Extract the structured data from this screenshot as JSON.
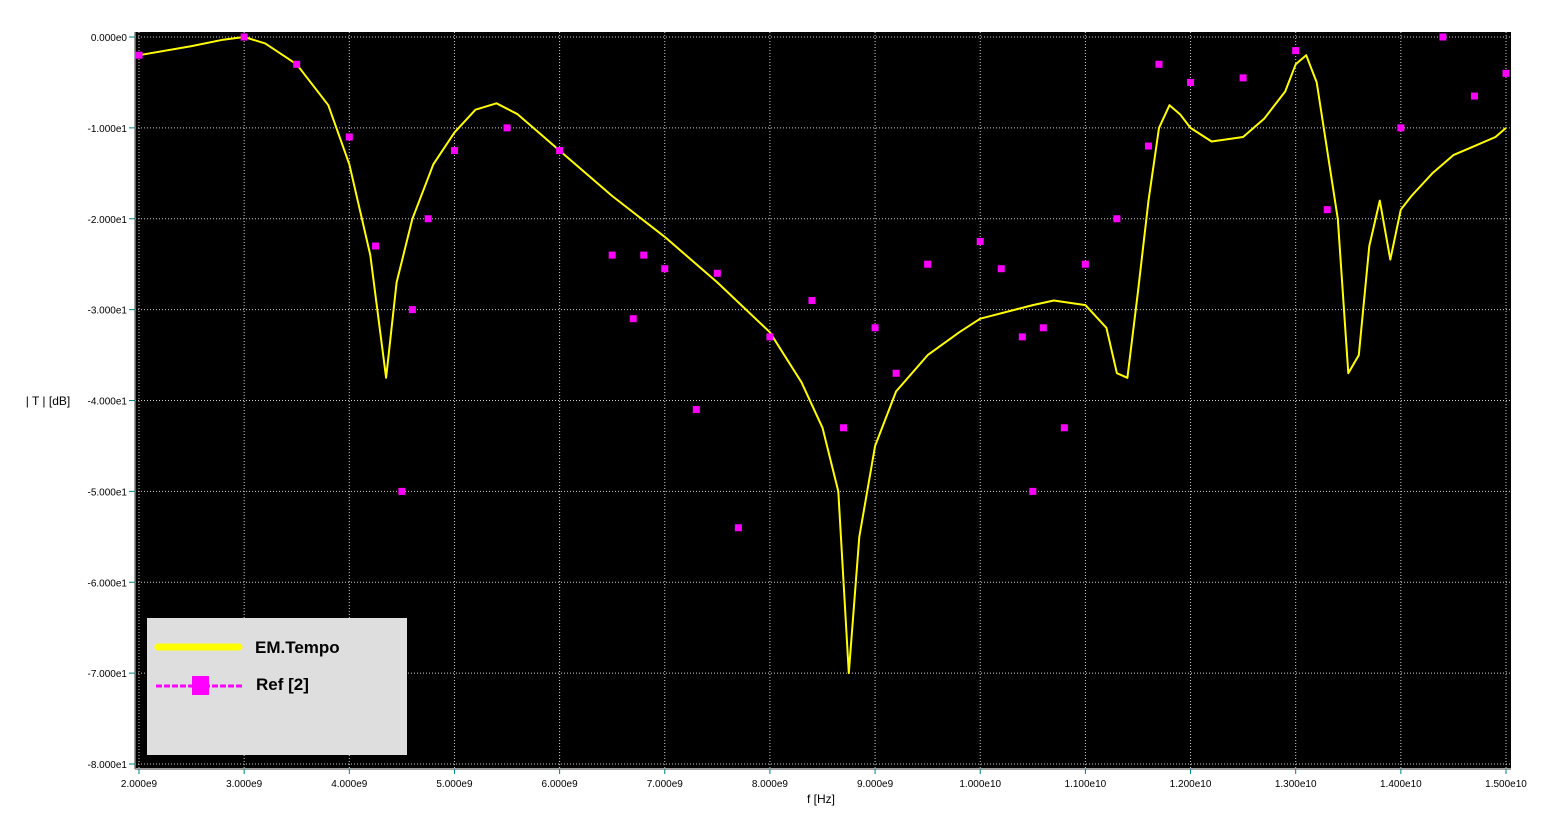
{
  "chart_data": {
    "type": "line",
    "title": "",
    "xlabel": "f [Hz]",
    "ylabel": "| T | [dB]",
    "xlim": [
      2000000000.0,
      15000000000.0
    ],
    "ylim": [
      -80,
      0
    ],
    "grid": true,
    "legend_position": "bottom-left",
    "x_ticks": [
      {
        "value": 2000000000.0,
        "label": "2.000e9"
      },
      {
        "value": 3000000000.0,
        "label": "3.000e9"
      },
      {
        "value": 4000000000.0,
        "label": "4.000e9"
      },
      {
        "value": 5000000000.0,
        "label": "5.000e9"
      },
      {
        "value": 6000000000.0,
        "label": "6.000e9"
      },
      {
        "value": 7000000000.0,
        "label": "7.000e9"
      },
      {
        "value": 8000000000.0,
        "label": "8.000e9"
      },
      {
        "value": 9000000000.0,
        "label": "9.000e9"
      },
      {
        "value": 10000000000.0,
        "label": "1.000e10"
      },
      {
        "value": 11000000000.0,
        "label": "1.100e10"
      },
      {
        "value": 12000000000.0,
        "label": "1.200e10"
      },
      {
        "value": 13000000000.0,
        "label": "1.300e10"
      },
      {
        "value": 14000000000.0,
        "label": "1.400e10"
      },
      {
        "value": 15000000000.0,
        "label": "1.500e10"
      }
    ],
    "y_ticks": [
      {
        "value": 0,
        "label": "0.000e0"
      },
      {
        "value": -10,
        "label": "-1.000e1"
      },
      {
        "value": -20,
        "label": "-2.000e1"
      },
      {
        "value": -30,
        "label": "-3.000e1"
      },
      {
        "value": -40,
        "label": "-4.000e1"
      },
      {
        "value": -50,
        "label": "-5.000e1"
      },
      {
        "value": -60,
        "label": "-6.000e1"
      },
      {
        "value": -70,
        "label": "-7.000e1"
      },
      {
        "value": -80,
        "label": "-8.000e1"
      }
    ],
    "series": [
      {
        "name": "EM.Tempo",
        "kind": "line",
        "color": "#ffff00",
        "x": [
          2000000000.0,
          2500000000.0,
          2800000000.0,
          3000000000.0,
          3200000000.0,
          3500000000.0,
          3800000000.0,
          4000000000.0,
          4200000000.0,
          4350000000.0,
          4450000000.0,
          4600000000.0,
          4800000000.0,
          5000000000.0,
          5200000000.0,
          5400000000.0,
          5600000000.0,
          6000000000.0,
          6500000000.0,
          7000000000.0,
          7500000000.0,
          8000000000.0,
          8300000000.0,
          8500000000.0,
          8650000000.0,
          8750000000.0,
          8850000000.0,
          9000000000.0,
          9200000000.0,
          9500000000.0,
          9800000000.0,
          10000000000.0,
          10500000000.0,
          10700000000.0,
          11000000000.0,
          11200000000.0,
          11300000000.0,
          11400000000.0,
          11500000000.0,
          11600000000.0,
          11700000000.0,
          11800000000.0,
          11900000000.0,
          12000000000.0,
          12200000000.0,
          12500000000.0,
          12700000000.0,
          12900000000.0,
          13000000000.0,
          13100000000.0,
          13200000000.0,
          13400000000.0,
          13500000000.0,
          13600000000.0,
          13700000000.0,
          13800000000.0,
          13900000000.0,
          14000000000.0,
          14100000000.0,
          14300000000.0,
          14500000000.0,
          14700000000.0,
          14900000000.0,
          15000000000.0
        ],
        "y": [
          -2,
          -1,
          -0.3,
          0,
          -0.7,
          -3,
          -7.5,
          -14,
          -24,
          -37.5,
          -27,
          -20,
          -14,
          -10.5,
          -8,
          -7.3,
          -8.5,
          -12.5,
          -17.5,
          -22,
          -27,
          -32.5,
          -38,
          -43,
          -50,
          -70,
          -55,
          -45,
          -39,
          -35,
          -32.5,
          -31,
          -29.5,
          -29,
          -29.5,
          -32,
          -37,
          -37.5,
          -28,
          -18,
          -10,
          -7.5,
          -8.5,
          -10,
          -11.5,
          -11,
          -9,
          -6,
          -3,
          -2,
          -5,
          -20,
          -37,
          -35,
          -23,
          -18,
          -24.5,
          -19,
          -17.5,
          -15,
          -13,
          -12,
          -11,
          -10
        ]
      },
      {
        "name": "Ref [2]",
        "kind": "scatter",
        "color": "#ff00ff",
        "x": [
          2000000000.0,
          3000000000.0,
          3500000000.0,
          4000000000.0,
          4250000000.0,
          4500000000.0,
          4600000000.0,
          4750000000.0,
          5000000000.0,
          5500000000.0,
          6000000000.0,
          6500000000.0,
          6700000000.0,
          6800000000.0,
          7000000000.0,
          7300000000.0,
          7500000000.0,
          7700000000.0,
          8000000000.0,
          8400000000.0,
          8700000000.0,
          9000000000.0,
          9200000000.0,
          9500000000.0,
          10000000000.0,
          10200000000.0,
          10400000000.0,
          10500000000.0,
          10600000000.0,
          10800000000.0,
          11000000000.0,
          11300000000.0,
          11600000000.0,
          11700000000.0,
          12000000000.0,
          12500000000.0,
          13000000000.0,
          13300000000.0,
          14000000000.0,
          14400000000.0,
          14700000000.0,
          15000000000.0
        ],
        "y": [
          -2,
          0,
          -3,
          -11,
          -23,
          -50,
          -30,
          -20,
          -12.5,
          -10,
          -12.5,
          -24,
          -31,
          -24,
          -25.5,
          -41,
          -26,
          -54,
          -33,
          -29,
          -43,
          -32,
          -37,
          -25,
          -22.5,
          -25.5,
          -33,
          -50,
          -32,
          -43,
          -25,
          -20,
          -12,
          -3,
          -5,
          -4.5,
          -1.5,
          -19,
          -10,
          0,
          -6.5,
          -4
        ]
      }
    ]
  }
}
